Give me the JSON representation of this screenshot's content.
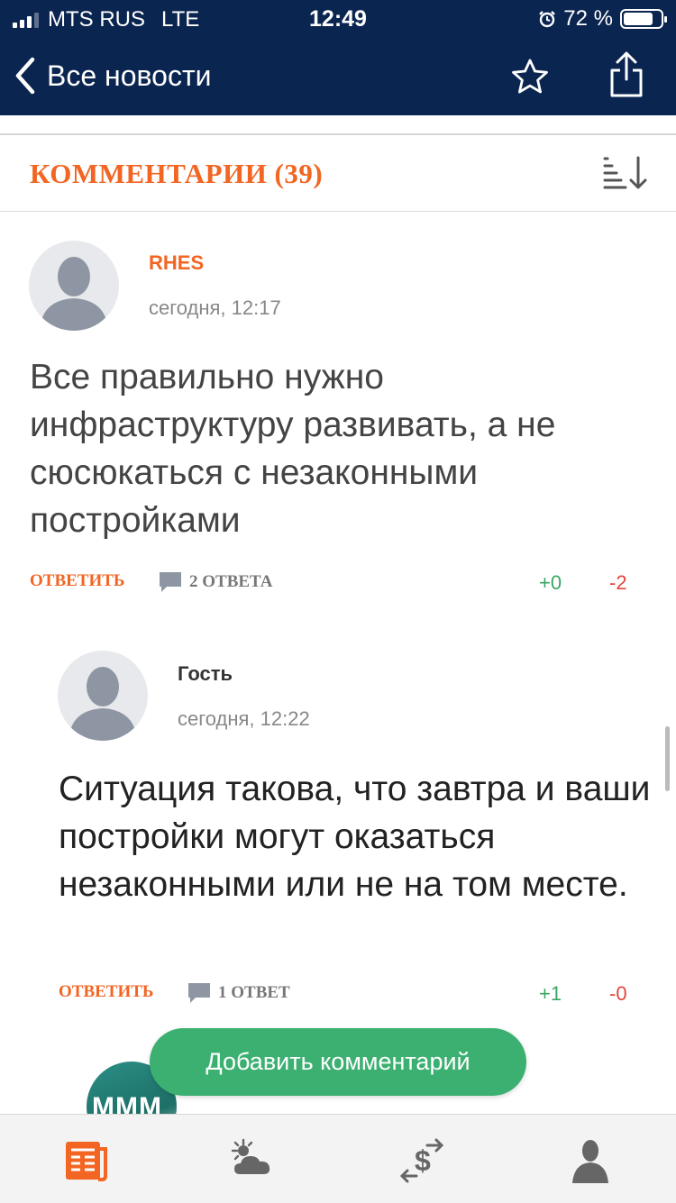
{
  "status_bar": {
    "carrier": "MTS RUS",
    "network": "LTE",
    "time": "12:49",
    "battery": "72 %",
    "battery_level": 0.72
  },
  "nav": {
    "back_label": "Все новости",
    "icons": [
      "back-chevron-icon",
      "star-icon",
      "share-icon"
    ]
  },
  "comments_header": {
    "title": "КОММЕНТАРИИ (39)",
    "sort_icon": "sort-descending-icon"
  },
  "comments": [
    {
      "author": "RHES",
      "time": "сегодня, 12:17",
      "text": "Все правильно нужно инфраструктуру развивать, а не сюсюкаться с незаконными постройками",
      "reply_label": "ОТВЕТИТЬ",
      "replies_label": "2 ОТВЕТА",
      "plus": "+0",
      "minus": "-2"
    },
    {
      "author": "Гость",
      "time": "сегодня, 12:22",
      "text": "Ситуация такова, что завтра и ваши постройки могут оказаться незаконными или не на том месте.",
      "reply_label": "ОТВЕТИТЬ",
      "replies_label": "1 ОТВЕТ",
      "plus": "+1",
      "minus": "-0"
    }
  ],
  "next_avatar": {
    "text": "MMM"
  },
  "add_comment_label": "Добавить комментарий",
  "tabbar": {
    "items": [
      "news-icon",
      "weather-icon",
      "currency-icon",
      "profile-icon"
    ],
    "active": "news-icon"
  },
  "colors": {
    "nav_bg": "#0b2551",
    "accent": "#f26522",
    "green": "#3bb071",
    "red": "#e2463a"
  }
}
